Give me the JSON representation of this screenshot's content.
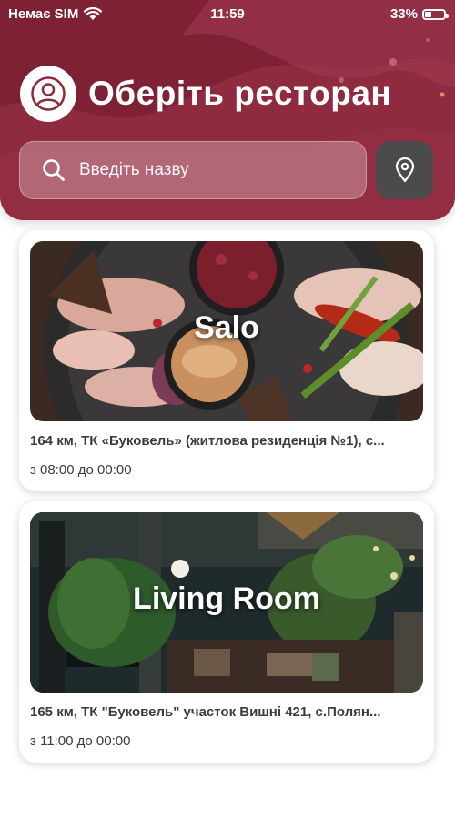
{
  "status_bar": {
    "carrier": "Немає SIM",
    "time": "11:59",
    "battery": "33%",
    "battery_level": 0.33
  },
  "header": {
    "title": "Оберіть ресторан",
    "search_placeholder": "Введіть назву",
    "accent_color": "#8e2b3f",
    "location_button_color": "#4b4a4c"
  },
  "restaurants": [
    {
      "name": "Salo",
      "address": "164 км, ТК «Буковель» (житлова резиденція №1), с...",
      "hours": "з 08:00 до 00:00"
    },
    {
      "name": "Living Room",
      "address": "165 км, ТК \"Буковель\" участок Вишні 421, с.Полян...",
      "hours": "з 11:00 до 00:00"
    }
  ]
}
